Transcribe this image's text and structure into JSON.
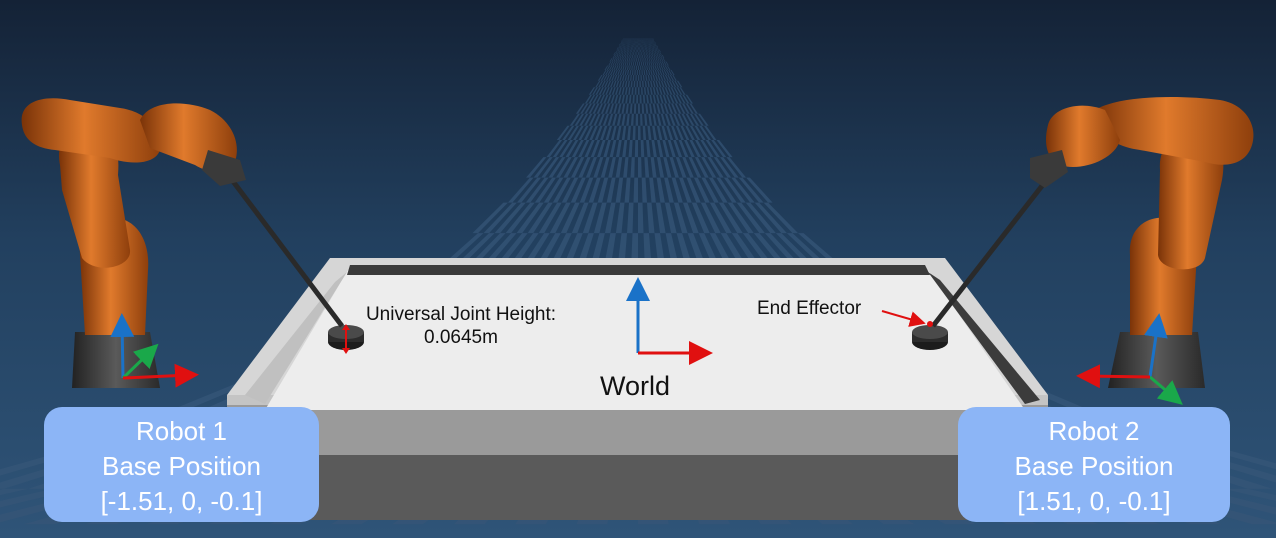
{
  "annotations": {
    "universal_joint_line1": "Universal Joint Height:",
    "universal_joint_line2": "0.0645m",
    "end_effector": "End Effector",
    "world": "World"
  },
  "robot1": {
    "title": "Robot 1",
    "subtitle": "Base Position",
    "position": "[-1.51, 0, -0.1]"
  },
  "robot2": {
    "title": "Robot 2",
    "subtitle": "Base Position",
    "position": "[1.51, 0, -0.1]"
  },
  "colors": {
    "robot_orange": "#d0651c",
    "robot_base": "#3a3a3a",
    "floor_dark": "#1b3150",
    "floor_light": "#355577",
    "table_top": "#ececec",
    "label_box": "#8cb5f6",
    "axis_x": "#e01010",
    "axis_y": "#1aa84a",
    "axis_z": "#1a72c8"
  }
}
